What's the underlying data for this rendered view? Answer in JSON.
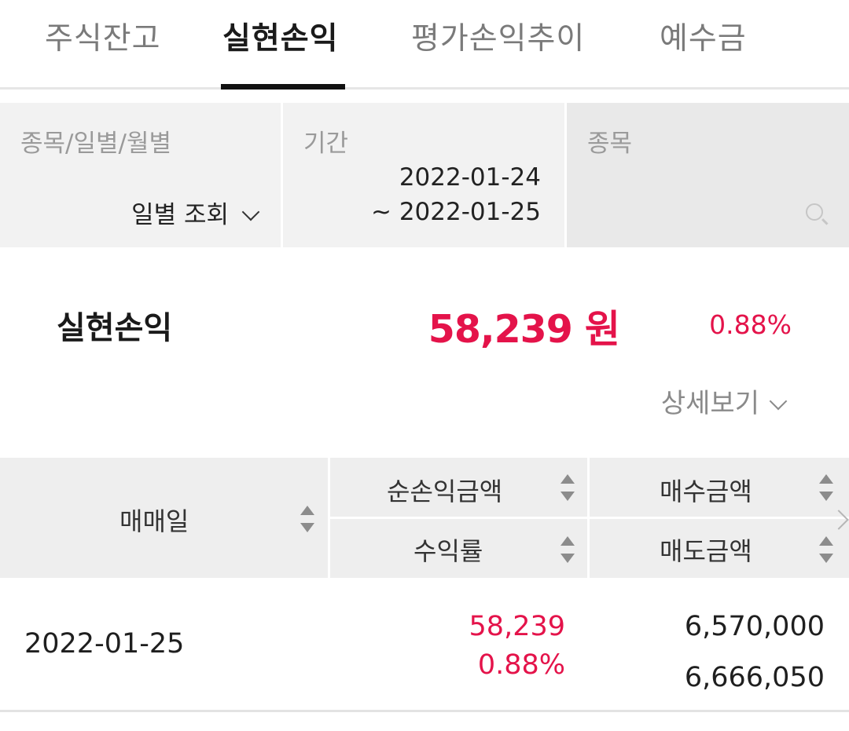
{
  "tabs": [
    "주식잔고",
    "실현손익",
    "평가손익추이",
    "예수금"
  ],
  "active_tab": "실현손익",
  "filters": {
    "type": {
      "label": "종목/일별/월별",
      "value": "일별 조회"
    },
    "period": {
      "label": "기간",
      "start": "2022-01-24",
      "end": "~ 2022-01-25"
    },
    "stock": {
      "label": "종목",
      "icon": "search-icon"
    }
  },
  "summary": {
    "label": "실현손익",
    "amount": "58,239 원",
    "rate": "0.88%",
    "detail_label": "상세보기"
  },
  "table": {
    "headers": {
      "date": "매매일",
      "net_profit": "순손익금액",
      "return_rate": "수익률",
      "buy_amount": "매수금액",
      "sell_amount": "매도금액"
    },
    "rows": [
      {
        "date": "2022-01-25",
        "net_profit": "58,239",
        "return_rate": "0.88%",
        "buy_amount": "6,570,000",
        "sell_amount": "6,666,050"
      }
    ]
  },
  "colors": {
    "accent": "#e4134a",
    "header_bg": "#eeeeee",
    "filter_bg": "#f2f2f2"
  }
}
